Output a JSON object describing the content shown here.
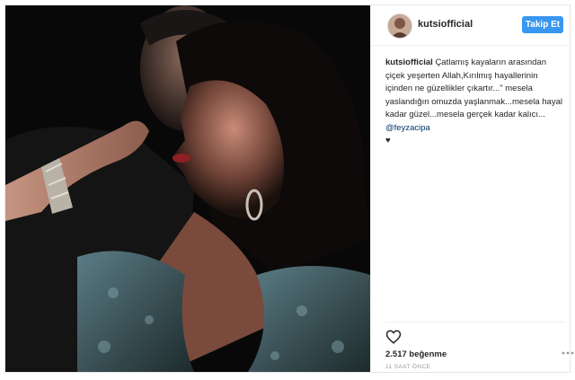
{
  "post": {
    "image_alt": "Selfie of a man and a woman in a dark setting",
    "username": "kutsiofficial",
    "follow_label": "Takip Et",
    "caption": {
      "username": "kutsiofficial",
      "text": "Çatlamış kayaların arasından çiçek yeşerten Allah,Kırılmış hayallerinin içinden ne güzellikler çıkartır...\" mesela yaslandığın omuzda yaşlanmak...mesela hayal kadar güzel...mesela gerçek kadar kalıcı...",
      "mention": "@feyzacipa",
      "emoji": "♥"
    },
    "likes": "2.517 beğenme",
    "timestamp": "11 SAAT ÖNCE"
  },
  "colors": {
    "follow_button": "#3897f0",
    "mention": "#003569",
    "border": "#e6e6e6"
  },
  "icons": {
    "like": "heart-outline-icon",
    "more": "more-options-icon"
  }
}
